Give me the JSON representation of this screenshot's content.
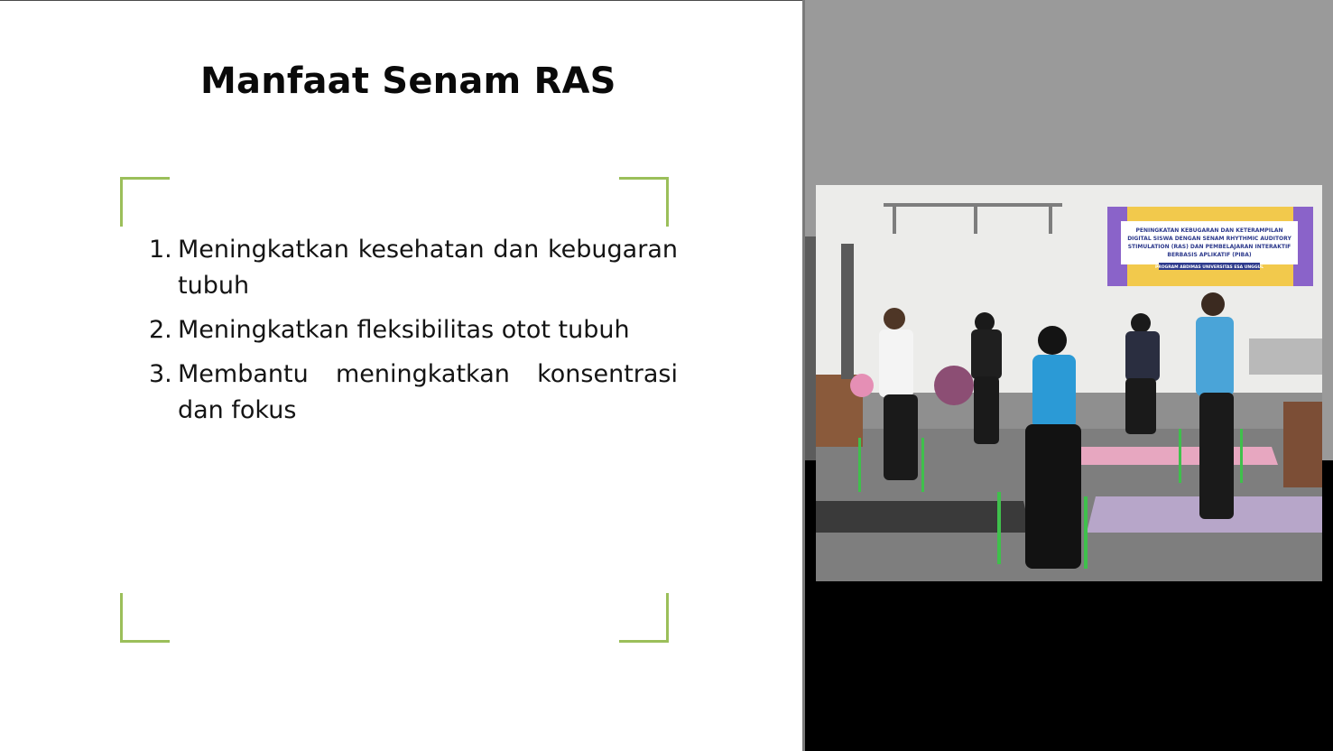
{
  "slide": {
    "title": "Manfaat Senam RAS",
    "benefits": [
      {
        "number": "1.",
        "text": "Meningkatkan kesehatan dan kebugaran tubuh"
      },
      {
        "number": "2.",
        "text": "Meningkatkan fleksibilitas otot tubuh"
      },
      {
        "number": "3.",
        "text": "Membantu meningkatkan konsentrasi dan fokus"
      }
    ],
    "accent_color": "#9bbf5a"
  },
  "photo": {
    "banner_lines": [
      "PENINGKATAN KEBUGARAN DAN KETERAMPILAN",
      "DIGITAL SISWA DENGAN SENAM RHYTHMIC AUDITORY",
      "STIMULATION (RAS) DAN PEMBELAJARAN INTERAKTIF",
      "BERBASIS APLIKATIF (PIBA)"
    ],
    "banner_footer": "PROGRAM ABDIMAS UNIVERSITAS ESA UNGGUL"
  }
}
